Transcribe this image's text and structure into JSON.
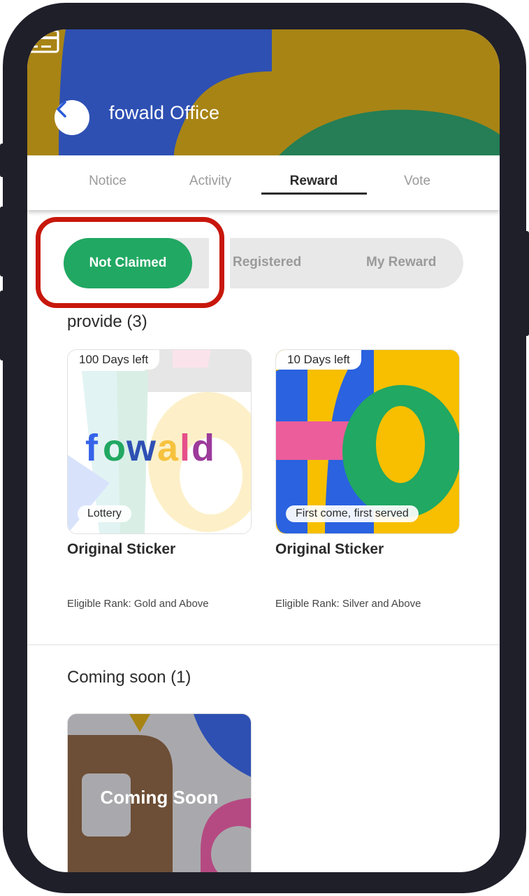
{
  "header": {
    "title": "fowald Office",
    "back_icon": "chevron-left-icon",
    "card_icon": "membership-card-icon"
  },
  "tabs": [
    {
      "label": "Notice",
      "active": false
    },
    {
      "label": "Activity",
      "active": false
    },
    {
      "label": "Reward",
      "active": true
    },
    {
      "label": "Vote",
      "active": false
    }
  ],
  "segments": [
    {
      "label": "Not Claimed",
      "active": true
    },
    {
      "label": "Registered",
      "active": false
    },
    {
      "label": "My Reward",
      "active": false
    }
  ],
  "provide_section": {
    "title": "provide (3)",
    "items": [
      {
        "days_left": "100 Days left",
        "badge": "Lottery",
        "logo_text": "fowald",
        "name": "Original Sticker",
        "rank": "Eligible Rank: Gold and Above"
      },
      {
        "days_left": "10 Days left",
        "badge": "First come, first served",
        "name": "Original Sticker",
        "rank": "Eligible Rank: Silver and Above"
      }
    ]
  },
  "coming_section": {
    "title": "Coming soon (1)",
    "items": [
      {
        "overlay": "Coming Soon"
      }
    ]
  },
  "colors": {
    "accent_green": "#21a862",
    "header_bg": "#a88415",
    "highlight_red": "#c8170c"
  }
}
